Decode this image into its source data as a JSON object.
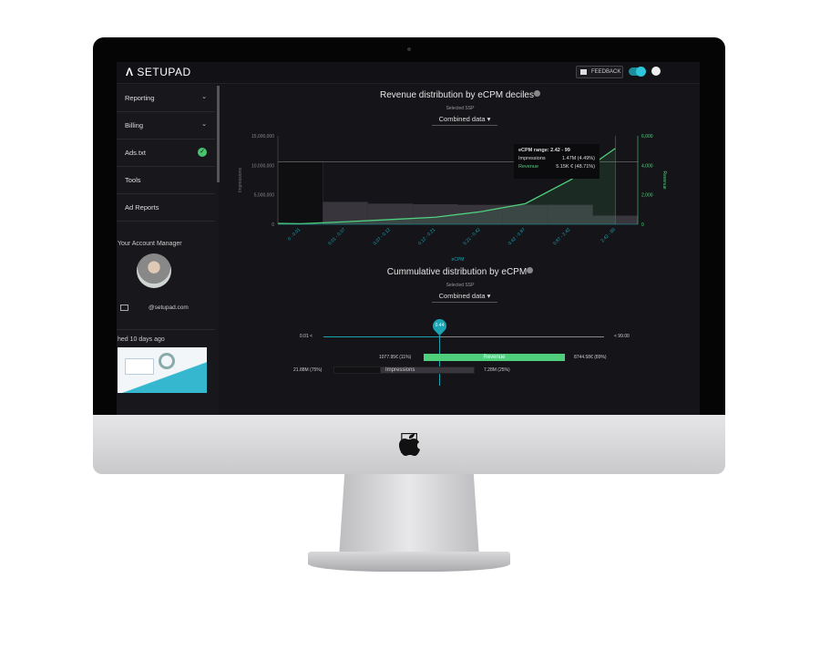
{
  "header": {
    "logo": "SETUPAD",
    "feedback_label": "FEEDBACK"
  },
  "sidebar": {
    "items": [
      {
        "label": "Reporting",
        "icon": "chevron-down-icon"
      },
      {
        "label": "Billing",
        "icon": "chevron-down-icon"
      },
      {
        "label": "Ads.txt",
        "icon": "check-circle-icon"
      },
      {
        "label": "Tools"
      },
      {
        "label": "Ad Reports"
      }
    ],
    "account_manager_title": "Your Account Manager",
    "email": "@setupad.com",
    "news_caption": "hed 10 days ago"
  },
  "chart1": {
    "title": "Revenue distribution by eCPM deciles",
    "ssp_label": "Selected SSP",
    "ssp_value": "Combined data",
    "tooltip": {
      "range": "eCPM range: 2.42 - 99",
      "impressions_label": "Impressions",
      "impressions_value": "1.47M (4.49%)",
      "revenue_label": "Revenue",
      "revenue_value": "5.15K € (48.71%)"
    }
  },
  "chart_data": {
    "type": "bar",
    "categories": [
      "0 - 0.01",
      "0.01 - 0.07",
      "0.07 - 0.12",
      "0.12 - 0.21",
      "0.21 - 0.42",
      "0.42 - 0.87",
      "0.87 - 2.42",
      "2.42 - 99"
    ],
    "xlabel": "eCPM",
    "ylabel": "Impressions",
    "y2label": "Revenue",
    "ylim": [
      0,
      15000000
    ],
    "y2lim": [
      0,
      6000
    ],
    "yticks": [
      "0",
      "5,000,000",
      "10,000,000",
      "15,000,000"
    ],
    "y2ticks": [
      "0",
      "2,000",
      "4,000",
      "6,000"
    ],
    "series": [
      {
        "name": "Impressions",
        "type": "bar",
        "values": [
          10600000,
          3800000,
          3500000,
          3400000,
          3300000,
          3300000,
          3300000,
          1470000
        ]
      },
      {
        "name": "Revenue",
        "type": "line",
        "values": [
          40,
          170,
          320,
          480,
          850,
          1400,
          3000,
          5150
        ]
      }
    ],
    "colors": {
      "bars": "#38353d",
      "line": "#4fd17f",
      "axis": "#1aa3b3"
    }
  },
  "chart2": {
    "title": "Cummulative distribution by eCPM",
    "ssp_label": "Selected SSP",
    "ssp_value": "Combined data",
    "slider_min": "0.01 <",
    "slider_max": "< 99.00",
    "slider_value": "0.44",
    "revenue_label": "Revenue",
    "revenue_left": "1077.95€ (11%)",
    "revenue_right": "8744.58€ (89%)",
    "impressions_label": "Impressions",
    "impressions_left": "21.88M (75%)",
    "impressions_right": "7.28M (25%)"
  }
}
